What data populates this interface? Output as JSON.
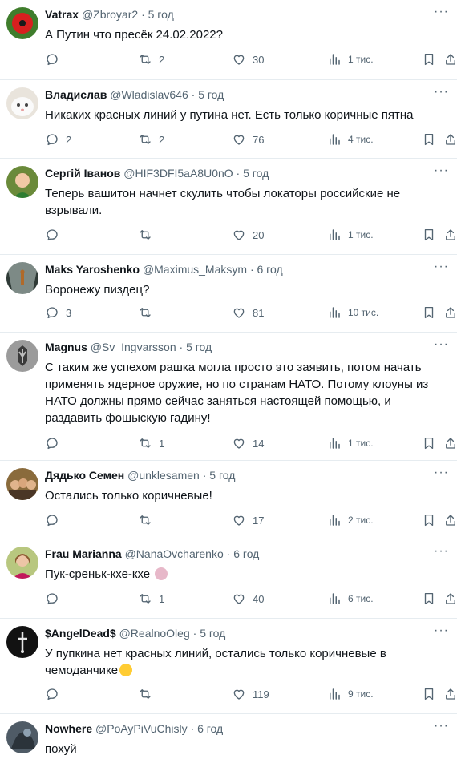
{
  "tweets": [
    {
      "name": "Vatrax",
      "handle": "@Zbroyar2",
      "time": "5 год",
      "text": "А Путин что пресёк 24.02.2022?",
      "replies": "",
      "retweets": "2",
      "likes": "30",
      "views": "1 тис."
    },
    {
      "name": "Владислав",
      "handle": "@Wladislav646",
      "time": "5 год",
      "text": "Никаких красных линий у путина нет. Есть только коричные пятна",
      "replies": "2",
      "retweets": "2",
      "likes": "76",
      "views": "4 тис."
    },
    {
      "name": "Сергій Іванов",
      "handle": "@HIF3DFI5aA8U0nO",
      "time": "5 год",
      "text": "Теперь вашитон начнет скулить чтобы локаторы российские не взрывали.",
      "replies": "",
      "retweets": "",
      "likes": "20",
      "views": "1 тис."
    },
    {
      "name": "Maks Yaroshenko",
      "handle": "@Maximus_Maksym",
      "time": "6 год",
      "text": "Воронежу пиздец?",
      "replies": "3",
      "retweets": "",
      "likes": "81",
      "views": "10 тис."
    },
    {
      "name": "Magnus",
      "handle": "@Sv_Ingvarsson",
      "time": "5 год",
      "text": "С таким же успехом рашка могла просто это заявить, потом начать применять ядерное оружие, но по странам НАТО. Потому клоуны из НАТО должны прямо сейчас заняться настоящей помощью, и раздавить фошыскую гадину!",
      "replies": "",
      "retweets": "1",
      "likes": "14",
      "views": "1 тис."
    },
    {
      "name": "Дядько Семен",
      "handle": "@unklesamen",
      "time": "5 год",
      "text": "Остались только коричневые!",
      "replies": "",
      "retweets": "",
      "likes": "17",
      "views": "2 тис."
    },
    {
      "name": "Frau Marianna",
      "handle": "@NanaOvcharenko",
      "time": "6 год",
      "text": "Пук-среньк-кхе-кхе",
      "replies": "",
      "retweets": "1",
      "likes": "40",
      "views": "6 тис."
    },
    {
      "name": "$AngelDead$",
      "handle": "@RealnoOleg",
      "time": "5 год",
      "text": "У пупкина нет красных линий, остались только коричневые в чемоданчике",
      "replies": "",
      "retweets": "",
      "likes": "119",
      "views": "9 тис."
    },
    {
      "name": "Nowhere",
      "handle": "@PoAyPiVuChisly",
      "time": "6 год",
      "text": "похуй",
      "replies": "",
      "retweets": "",
      "likes": "",
      "views": ""
    }
  ],
  "icons": {
    "reply": "reply-icon",
    "retweet": "retweet-icon",
    "like": "heart-icon",
    "views": "views-icon",
    "bookmark": "bookmark-icon",
    "share": "share-icon",
    "more": "more-icon"
  },
  "colors": {
    "text": "#0f1419",
    "secondary": "#536471",
    "divider": "#e6ecf0"
  }
}
